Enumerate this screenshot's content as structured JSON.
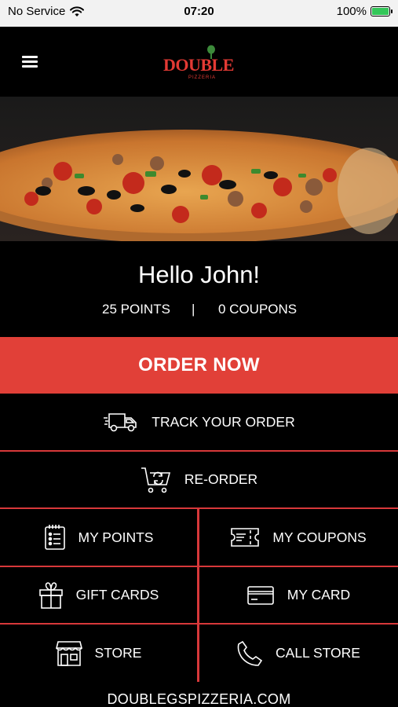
{
  "status_bar": {
    "carrier": "No Service",
    "time": "07:20",
    "battery": "100%"
  },
  "header": {
    "logo_text": "DOUBLE G's",
    "logo_sub": "PIZZERIA"
  },
  "greeting": "Hello John!",
  "stats": {
    "points": "25 POINTS",
    "separator": "|",
    "coupons": "0 COUPONS"
  },
  "order_now": "ORDER NOW",
  "menu": {
    "track": "TRACK YOUR ORDER",
    "reorder": "RE-ORDER",
    "my_points": "MY POINTS",
    "my_coupons": "MY COUPONS",
    "gift_cards": "GIFT CARDS",
    "my_card": "MY CARD",
    "store": "STORE",
    "call_store": "CALL STORE"
  },
  "website": "DOUBLEGSPIZZERIA.COM",
  "colors": {
    "accent": "#e14038",
    "divider": "#d7383a",
    "background": "#000000"
  }
}
